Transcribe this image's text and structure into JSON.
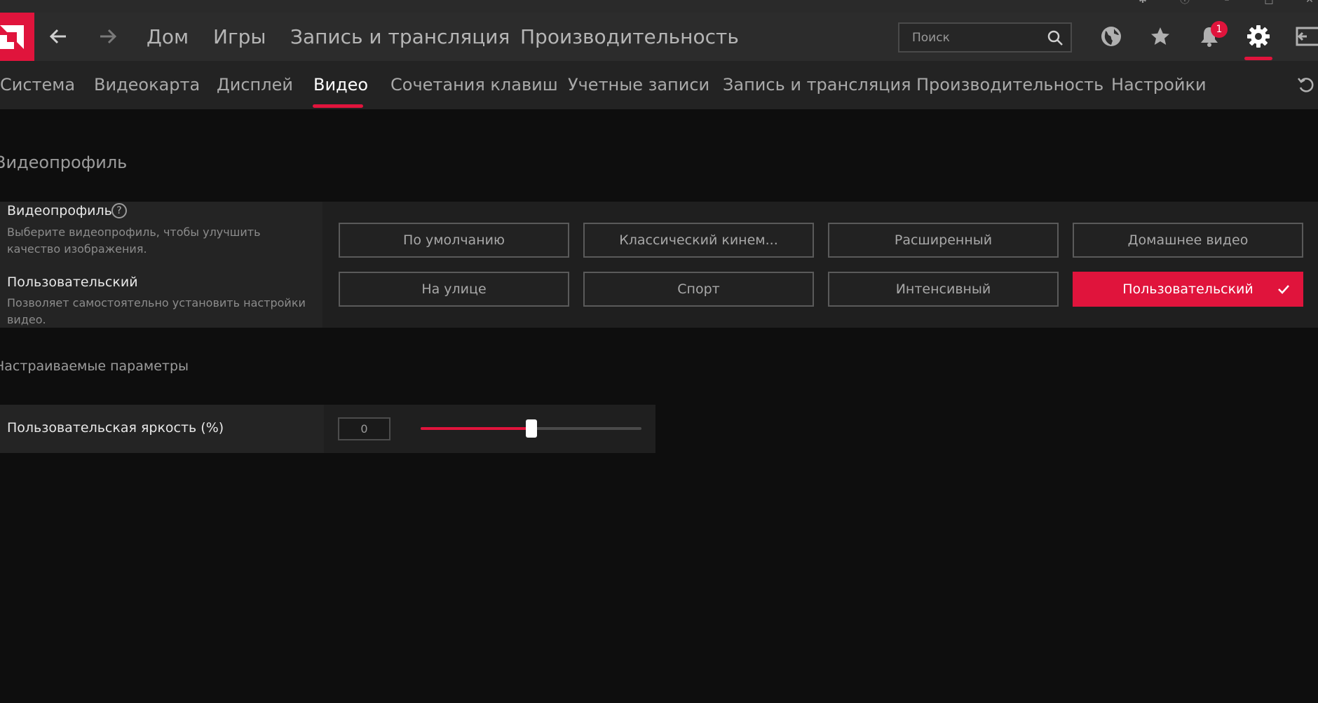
{
  "top_nav": {
    "items": [
      "Дом",
      "Игры",
      "Запись и трансляция",
      "Производительность"
    ],
    "search_placeholder": "Поиск",
    "notification_count": "1"
  },
  "sub_nav": {
    "items": [
      "Система",
      "Видеокарта",
      "Дисплей",
      "Видео",
      "Сочетания клавиш",
      "Учетные записи",
      "Запись и трансляция",
      "Производительность",
      "Настройки"
    ],
    "active": "Видео"
  },
  "video_profile": {
    "section_title": "Видеопрофиль",
    "label": "Видеопрофиль",
    "description": "Выберите видеопрофиль, чтобы улучшить качество изображения.",
    "selected_label": "Пользовательский",
    "selected_description": "Позволяет самостоятельно установить настройки видео.",
    "options": [
      "По умолчанию",
      "Классический кинем...",
      "Расширенный",
      "Домашнее видео",
      "На улице",
      "Спорт",
      "Интенсивный",
      "Пользовательский"
    ],
    "selected_option": "Пользовательский"
  },
  "custom_params": {
    "section_title": "Настраиваемые параметры",
    "brightness_label": "Пользовательская яркость (%)",
    "brightness_value": "0",
    "brightness_slider_fraction": 0.5
  },
  "colors": {
    "accent": "#e0143c",
    "background": "#0e0e0e",
    "nav_bg": "#2c2c2c"
  }
}
